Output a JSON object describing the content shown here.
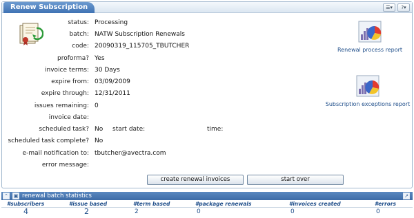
{
  "panel": {
    "title": "Renew Subscription"
  },
  "form": {
    "rows": [
      {
        "label": "status:",
        "value": "Processing"
      },
      {
        "label": "batch:",
        "value": "NATW Subscription Renewals"
      },
      {
        "label": "code:",
        "value": "20090319_115705_TBUTCHER"
      },
      {
        "label": "proforma?",
        "value": "Yes"
      },
      {
        "label": "invoice terms:",
        "value": "30 Days"
      },
      {
        "label": "expire from:",
        "value": "03/09/2009"
      },
      {
        "label": "expire through:",
        "value": "12/31/2011"
      },
      {
        "label": "issues remaining:",
        "value": "0"
      },
      {
        "label": "invoice date:",
        "value": ""
      },
      {
        "label": "scheduled task?",
        "value": "No"
      },
      {
        "label": "scheduled task complete?",
        "value": "No"
      },
      {
        "label": "e-mail notification to:",
        "value": "tbutcher@avectra.com"
      },
      {
        "label": "error message:",
        "value": ""
      }
    ],
    "start_date_label": "start date:",
    "time_label": "time:"
  },
  "reports": {
    "renewal_process": "Renewal process report",
    "subscription_exceptions": "Subscription exceptions report"
  },
  "buttons": {
    "create_invoices": "create renewal invoices",
    "start_over": "start over"
  },
  "stats": {
    "title": "renewal batch statistics",
    "columns": [
      {
        "header": "#subscribers",
        "value": "4"
      },
      {
        "header": "#issue based",
        "value": "2"
      },
      {
        "header": "#term based",
        "value": "2"
      },
      {
        "header": "#package renewals",
        "value": "0"
      },
      {
        "header": "#invoices created",
        "value": "0"
      },
      {
        "header": "#errors",
        "value": "0"
      }
    ]
  }
}
